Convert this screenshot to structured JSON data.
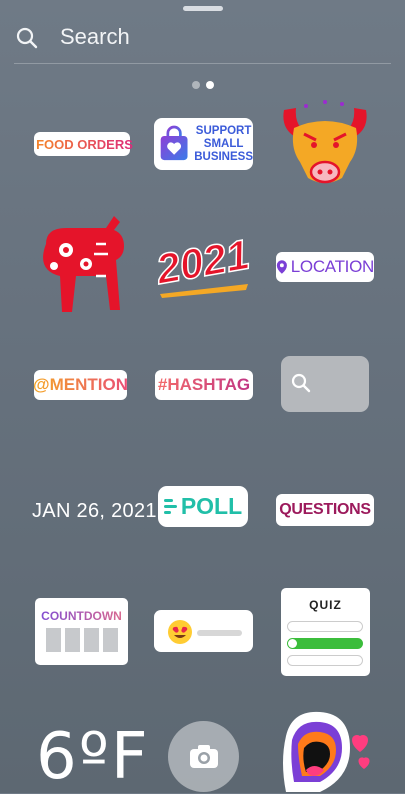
{
  "search": {
    "label": "Search"
  },
  "pager": {
    "pages": 2,
    "current": 2
  },
  "stickers": {
    "food_orders": "FOOD ORDERS",
    "support_small_business": [
      "SUPPORT",
      "SMALL",
      "BUSINESS"
    ],
    "year_2021": "2021",
    "location": "LOCATION",
    "mention": "@MENTION",
    "hashtag": "#HASHTAG",
    "date": "JAN 26, 2021",
    "poll": "POLL",
    "questions": "QUESTIONS",
    "countdown": "COUNTDOWN",
    "quiz": "QUIZ",
    "temperature": "6ºF"
  },
  "colors": {
    "background": "#6b7682",
    "accent_red": "#e5142a",
    "poll_teal": "#21bfa8",
    "location_purple": "#7b3fd6",
    "questions_magenta": "#9c1a5c",
    "quiz_green": "#3bbd3b"
  },
  "icons": {
    "search": "search-icon",
    "truck": "truck-icon",
    "bag": "shopping-bag-heart-icon",
    "ox_head": "ox-head-icon",
    "ox_papercut": "papercut-ox-icon",
    "pin": "location-pin-icon",
    "camera": "camera-icon",
    "heart_eyes": "heart-eyes-emoji-icon",
    "mouth": "mouth-heart-icon"
  }
}
